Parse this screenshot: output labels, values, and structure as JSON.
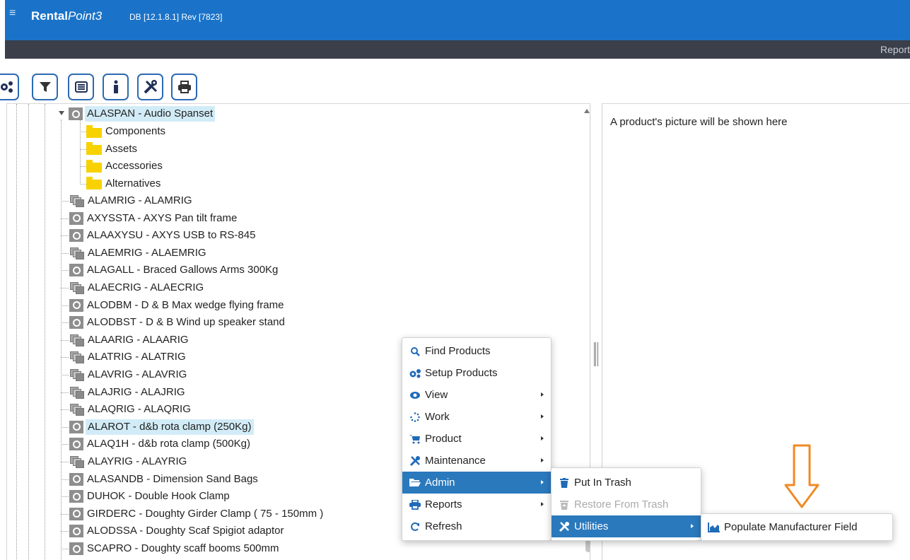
{
  "app": {
    "title_a": "Rental",
    "title_b": "Point3",
    "meta": "DB [12.1.8.1]  Rev [7823]"
  },
  "darkbar": {
    "reports_label": "Report"
  },
  "toolbar": {
    "buttons": [
      "setup-products-icon",
      "filter-icon",
      "list-icon",
      "info-icon",
      "tools-icon",
      "print-icon"
    ]
  },
  "tree": {
    "selected": {
      "label": "ALASPAN - Audio Spanset"
    },
    "children": [
      {
        "label": "Components"
      },
      {
        "label": "Assets"
      },
      {
        "label": "Accessories"
      },
      {
        "label": "Alternatives"
      }
    ],
    "items": [
      {
        "type": "rig",
        "label": "ALAMRIG - ALAMRIG"
      },
      {
        "type": "product",
        "label": "AXYSSTA - AXYS Pan tilt frame"
      },
      {
        "type": "product",
        "label": "ALAAXYSU - AXYS USB to RS-845"
      },
      {
        "type": "rig",
        "label": "ALAEMRIG - ALAEMRIG"
      },
      {
        "type": "product",
        "label": "ALAGALL - Braced Gallows Arms 300Kg"
      },
      {
        "type": "rig",
        "label": "ALAECRIG - ALAECRIG"
      },
      {
        "type": "product",
        "label": "ALODBM - D & B Max wedge flying frame"
      },
      {
        "type": "product",
        "label": "ALODBST - D & B Wind up speaker stand"
      },
      {
        "type": "rig",
        "label": "ALAARIG - ALAARIG"
      },
      {
        "type": "rig",
        "label": "ALATRIG - ALATRIG"
      },
      {
        "type": "rig",
        "label": "ALAVRIG - ALAVRIG"
      },
      {
        "type": "rig",
        "label": "ALAJRIG - ALAJRIG"
      },
      {
        "type": "rig",
        "label": "ALAQRIG - ALAQRIG"
      },
      {
        "type": "product",
        "label": "ALAROT - d&b rota clamp (250Kg)",
        "highlight": true
      },
      {
        "type": "product",
        "label": "ALAQ1H - d&b rota clamp (500Kg)"
      },
      {
        "type": "rig",
        "label": "ALAYRIG - ALAYRIG"
      },
      {
        "type": "product",
        "label": "ALASANDB - Dimension Sand Bags"
      },
      {
        "type": "product",
        "label": "DUHOK - Double Hook Clamp"
      },
      {
        "type": "product",
        "label": "GIRDERC - Doughty Girder Clamp ( 75 - 150mm )"
      },
      {
        "type": "product",
        "label": "ALODSSA - Doughty Scaf Spigiot adaptor"
      },
      {
        "type": "product",
        "label": "SCAPRO - Doughty scaff booms 500mm"
      }
    ]
  },
  "picture_pane": {
    "text": "A product's picture will be shown here"
  },
  "context_menu": {
    "items": [
      {
        "label": "Find Products",
        "icon": "search-icon",
        "submenu": false
      },
      {
        "label": "Setup Products",
        "icon": "cogs-icon",
        "submenu": false
      },
      {
        "label": "View",
        "icon": "eye-icon",
        "submenu": true
      },
      {
        "label": "Work",
        "icon": "spinner-icon",
        "submenu": true
      },
      {
        "label": "Product",
        "icon": "cart-icon",
        "submenu": true
      },
      {
        "label": "Maintenance",
        "icon": "tools-icon",
        "submenu": true
      },
      {
        "label": "Admin",
        "icon": "folder-open-icon",
        "submenu": true,
        "active": true
      },
      {
        "label": "Reports",
        "icon": "print-icon",
        "submenu": true
      },
      {
        "label": "Refresh",
        "icon": "refresh-icon",
        "submenu": false
      }
    ]
  },
  "admin_submenu": {
    "items": [
      {
        "label": "Put In Trash",
        "icon": "trash-icon"
      },
      {
        "label": "Restore From Trash",
        "icon": "restore-trash-icon",
        "disabled": true
      },
      {
        "label": "Utilities",
        "icon": "tools-icon",
        "active": true,
        "submenu": true
      }
    ]
  },
  "utilities_submenu": {
    "items": [
      {
        "label": "Populate Manufacturer Field",
        "icon": "area-chart-icon"
      }
    ]
  },
  "colors": {
    "topbar": "#1a73c8",
    "darkbar": "#3a3f4a",
    "menu_active": "#2a79bd",
    "annotation_arrow": "#f08a24",
    "selection": "#d2ecf7"
  }
}
